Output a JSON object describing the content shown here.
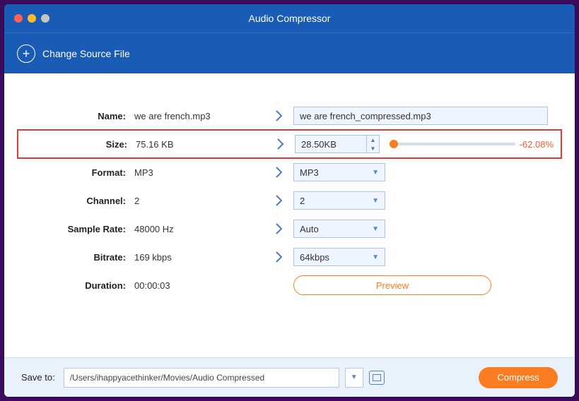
{
  "title": "Audio Compressor",
  "change_source": "Change Source File",
  "rows": {
    "name": {
      "label": "Name:",
      "orig": "we are french.mp3",
      "out": "we are french_compressed.mp3"
    },
    "size": {
      "label": "Size:",
      "orig": "75.16 KB",
      "out": "28.50KB",
      "pct": "-62.08%"
    },
    "format": {
      "label": "Format:",
      "orig": "MP3",
      "out": "MP3"
    },
    "channel": {
      "label": "Channel:",
      "orig": "2",
      "out": "2"
    },
    "sample": {
      "label": "Sample Rate:",
      "orig": "48000 Hz",
      "out": "Auto"
    },
    "bitrate": {
      "label": "Bitrate:",
      "orig": "169 kbps",
      "out": "64kbps"
    },
    "duration": {
      "label": "Duration:",
      "orig": "00:00:03"
    }
  },
  "preview": "Preview",
  "footer": {
    "label": "Save to:",
    "path": "/Users/ihappyacethinker/Movies/Audio Compressed",
    "compress": "Compress"
  }
}
